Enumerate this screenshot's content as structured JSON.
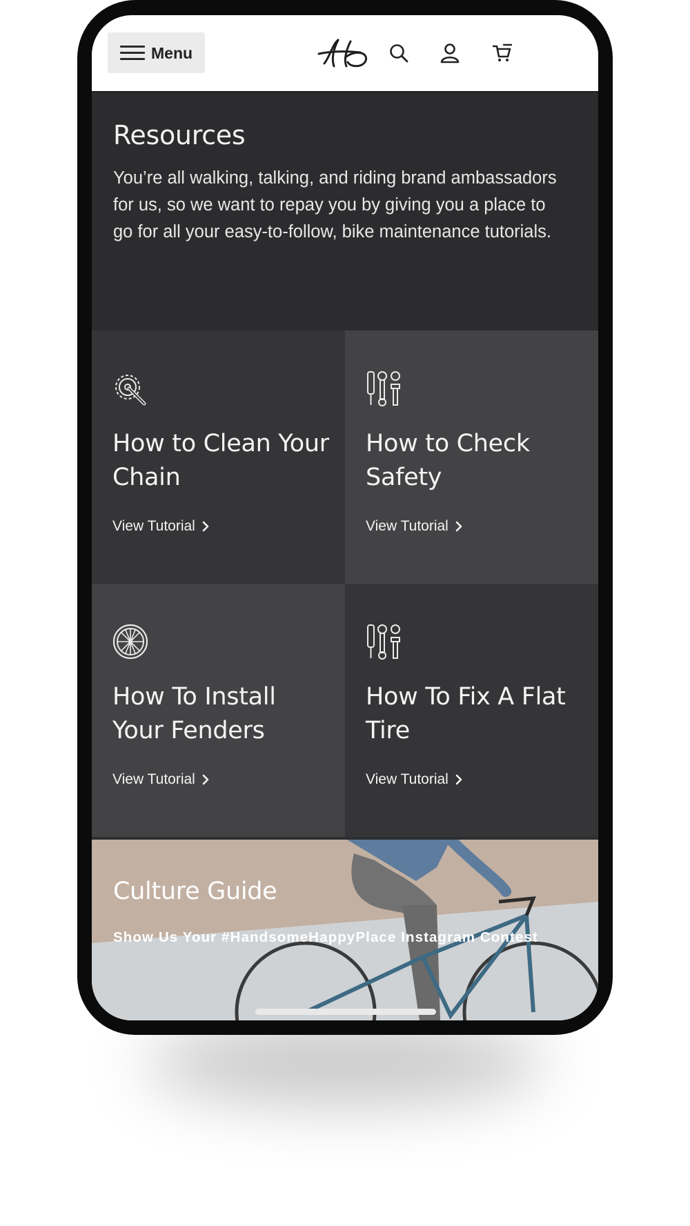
{
  "header": {
    "menu_label": "Menu"
  },
  "resources": {
    "title": "Resources",
    "description": "You’re all walking, talking, and riding brand ambassadors for us, so we want to repay you by giving you a place to go for all your easy-to-follow, bike maintenance tutorials."
  },
  "tutorials": [
    {
      "title": "How to Clean Your Chain",
      "link": "View Tutorial",
      "icon": "gear-wrench-icon"
    },
    {
      "title": "How to Check Safety",
      "link": "View Tutorial",
      "icon": "tools-icon"
    },
    {
      "title": "How To Install Your Fenders",
      "link": "View Tutorial",
      "icon": "wheel-icon"
    },
    {
      "title": "How To Fix A Flat Tire",
      "link": "View Tutorial",
      "icon": "tools-icon"
    }
  ],
  "culture": {
    "title": "Culture Guide",
    "subtitle": "Show Us Your #HandsomeHappyPlace Instagram Contest"
  },
  "colors": {
    "header_bg": "#ffffff",
    "dark_tile": "#353537",
    "light_tile": "#434345",
    "text": "#f4f4f4"
  }
}
